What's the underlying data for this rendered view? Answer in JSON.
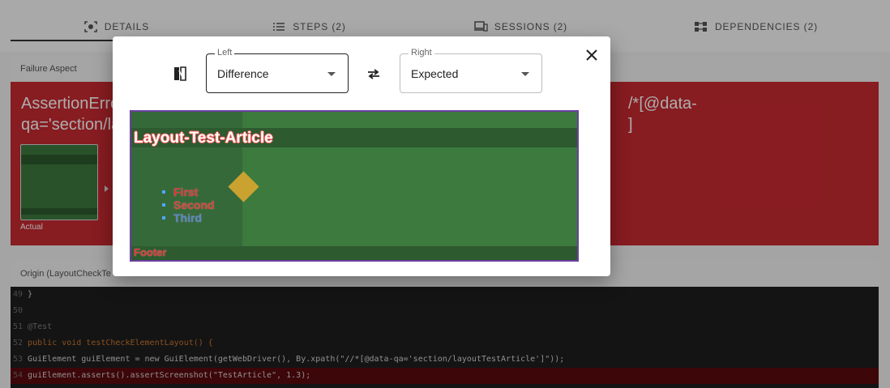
{
  "tabs": [
    {
      "label": "DETAILS",
      "icon": "details-icon"
    },
    {
      "label": "STEPS (2)",
      "icon": "list-icon"
    },
    {
      "label": "SESSIONS (2)",
      "icon": "devices-icon"
    },
    {
      "label": "DEPENDENCIES (2)",
      "icon": "dependencies-icon"
    }
  ],
  "failure": {
    "header": "Failure Aspect",
    "message_left": "AssertionErro",
    "message_left_line2": "qa='section/la",
    "message_right": "/*[@data-",
    "message_right_line2": "]",
    "thumb_label": "Actual"
  },
  "origin": {
    "header": "Origin (LayoutCheckTe",
    "lines": [
      {
        "n": "49",
        "text": "}"
      },
      {
        "n": "50",
        "text": ""
      },
      {
        "n": "51",
        "text": "@Test"
      },
      {
        "n": "52",
        "text": "public void testCheckElementLayout() {"
      },
      {
        "n": "53",
        "text": "GuiElement guiElement = new GuiElement(getWebDriver(), By.xpath(\"//*[@data-qa='section/layoutTestArticle']\"));"
      },
      {
        "n": "54",
        "text": "guiElement.asserts().assertScreenshot(\"TestArticle\", 1.3);"
      }
    ]
  },
  "dialog": {
    "left_label": "Left",
    "left_value": "Difference",
    "right_label": "Right",
    "right_value": "Expected",
    "image": {
      "title": "Layout-Test-Article",
      "items": [
        "First",
        "Second",
        "Third"
      ],
      "footer": "Footer"
    }
  },
  "colors": {
    "failure_red": "#c82a32",
    "diff_border": "#6a3fa0",
    "diff_green": "#3c7a3d"
  }
}
